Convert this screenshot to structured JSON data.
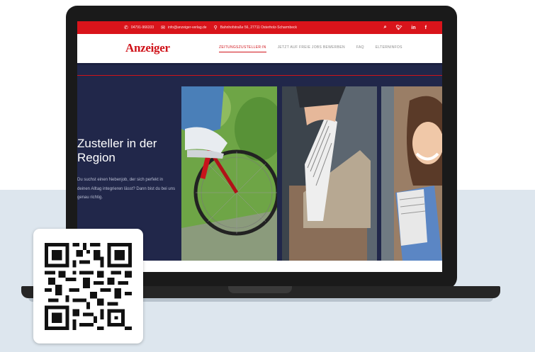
{
  "colors": {
    "brand_red": "#d9141b",
    "hero_bg": "#21274a",
    "page_band": "#dde6ee"
  },
  "topbar": {
    "phone_icon": "phone-icon",
    "phone": "04791-966333",
    "mail_icon": "envelope-icon",
    "email": "info@anzeiger-verlag.de",
    "location_icon": "map-pin-icon",
    "address": "Bahnhofstraße 56, 27711 Osterholz-Scharmbeck",
    "social": [
      "search-icon",
      "twitter-icon",
      "linkedin-icon",
      "facebook-icon"
    ],
    "social_glyphs": [
      "🔍",
      "🐦",
      "in",
      "f"
    ]
  },
  "nav": {
    "logo": "Anzeiger",
    "items": [
      {
        "label": "ZEITUNGSZUSTELLER:IN",
        "active": true
      },
      {
        "label": "JETZT AUF FREIE JOBS BEWERBEN",
        "active": false
      },
      {
        "label": "FAQ",
        "active": false
      },
      {
        "label": "ELTERNINFOS",
        "active": false
      }
    ]
  },
  "hero": {
    "title": "Zusteller in der Region",
    "text": "Du suchst einen Nebenjob, der sich perfekt in deinen Alltag integrieren lässt? Dann bist du bei uns genau richtig."
  }
}
